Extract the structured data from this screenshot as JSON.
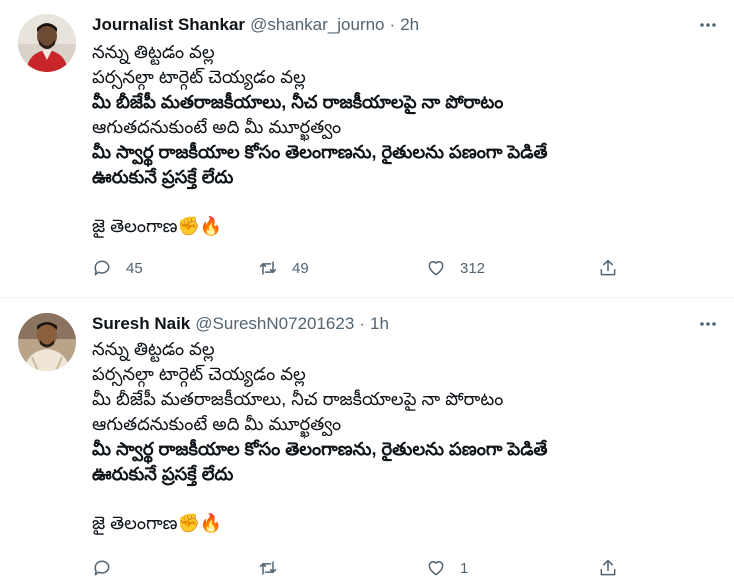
{
  "tweets": [
    {
      "name": "Journalist Shankar",
      "handle": "@shankar_journo",
      "separator": "·",
      "time": "2h",
      "lines": [
        {
          "text": "నన్ను తిట్టడం వల్ల",
          "bold": false
        },
        {
          "text": "పర్సనల్గా టార్గెట్ చెయ్యడం వల్ల",
          "bold": false
        },
        {
          "text": "మీ బీజేపీ మతరాజకీయాలు, నీచ రాజకీయాలపై నా పోరాటం",
          "bold": false
        },
        {
          "text": "ఆగుతదనుకుంటే అది మీ మూర్ఖత్వం",
          "bold": false
        },
        {
          "text": "మీ స్వార్థ రాజకీయాల కోసం తెలంగాణను, రైతులను పణంగా పెడితే",
          "bold": true
        },
        {
          "text": "ఊరుకునే ప్రసక్తే లేదు",
          "bold": true
        }
      ],
      "footer_text": "జై తెలంగాణ",
      "footer_emoji": "✊🔥",
      "replies": "45",
      "retweets": "49",
      "likes": "312"
    },
    {
      "name": "Suresh Naik",
      "handle": "@SureshN07201623",
      "separator": "·",
      "time": "1h",
      "lines": [
        {
          "text": "నన్ను తిట్టడం వల్ల",
          "bold": false
        },
        {
          "text": "పర్సనల్గా టార్గెట్ చెయ్యడం వల్ల",
          "bold": false
        },
        {
          "text": "మీ బీజేపీ మతరాజకీయాలు, నీచ రాజకీయాలపై నా పోరాటం",
          "bold": false
        },
        {
          "text": "ఆగుతదనుకుంటే అది మీ మూర్ఖత్వం",
          "bold": false
        },
        {
          "text": "మీ స్వార్థ రాజకీయాల కోసం తెలంగాణను, రైతులను పణంగా పెడితే",
          "bold": true
        },
        {
          "text": "ఊరుకునే ప్రసక్తే లేదు",
          "bold": true
        }
      ],
      "footer_text": "జై తెలంగాణ",
      "footer_emoji": "✊🔥",
      "replies": "",
      "retweets": "",
      "likes": "1"
    }
  ],
  "icons": {
    "more": "more-horizontal-icon",
    "reply": "reply-bubble-icon",
    "retweet": "retweet-arrows-icon",
    "like": "heart-icon",
    "share": "share-upload-icon"
  },
  "colors": {
    "text": "#0f1419",
    "secondary": "#536471",
    "divider": "#eff3f4"
  }
}
